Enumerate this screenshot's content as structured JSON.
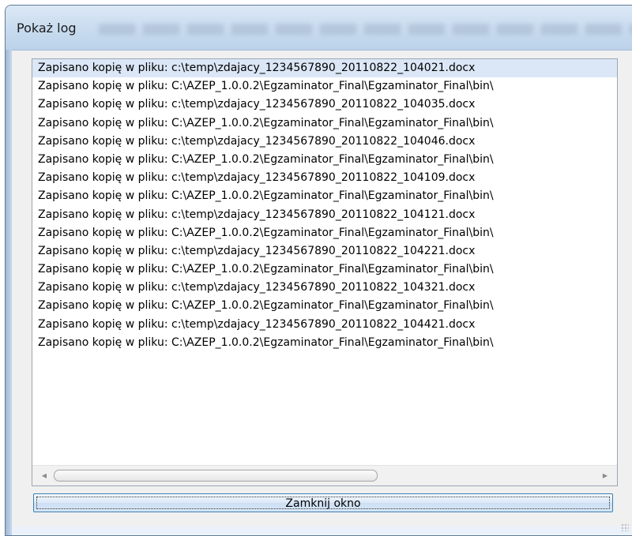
{
  "window": {
    "title": "Pokaż log"
  },
  "log": {
    "selected_index": 0,
    "entries": [
      "Zapisano kopię w pliku: c:\\temp\\zdajacy_1234567890_20110822_104021.docx",
      "Zapisano kopię w pliku: C:\\AZEP_1.0.0.2\\Egzaminator_Final\\Egzaminator_Final\\bin\\",
      "Zapisano kopię w pliku: c:\\temp\\zdajacy_1234567890_20110822_104035.docx",
      "Zapisano kopię w pliku: C:\\AZEP_1.0.0.2\\Egzaminator_Final\\Egzaminator_Final\\bin\\",
      "Zapisano kopię w pliku: c:\\temp\\zdajacy_1234567890_20110822_104046.docx",
      "Zapisano kopię w pliku: C:\\AZEP_1.0.0.2\\Egzaminator_Final\\Egzaminator_Final\\bin\\",
      "Zapisano kopię w pliku: c:\\temp\\zdajacy_1234567890_20110822_104109.docx",
      "Zapisano kopię w pliku: C:\\AZEP_1.0.0.2\\Egzaminator_Final\\Egzaminator_Final\\bin\\",
      "Zapisano kopię w pliku: c:\\temp\\zdajacy_1234567890_20110822_104121.docx",
      "Zapisano kopię w pliku: C:\\AZEP_1.0.0.2\\Egzaminator_Final\\Egzaminator_Final\\bin\\",
      "Zapisano kopię w pliku: c:\\temp\\zdajacy_1234567890_20110822_104221.docx",
      "Zapisano kopię w pliku: C:\\AZEP_1.0.0.2\\Egzaminator_Final\\Egzaminator_Final\\bin\\",
      "Zapisano kopię w pliku: c:\\temp\\zdajacy_1234567890_20110822_104321.docx",
      "Zapisano kopię w pliku: C:\\AZEP_1.0.0.2\\Egzaminator_Final\\Egzaminator_Final\\bin\\",
      "Zapisano kopię w pliku: c:\\temp\\zdajacy_1234567890_20110822_104421.docx",
      "Zapisano kopię w pliku: C:\\AZEP_1.0.0.2\\Egzaminator_Final\\Egzaminator_Final\\bin\\"
    ]
  },
  "close_button": {
    "label": "Zamknij okno"
  },
  "icons": {
    "scroll_left": "scroll-left-arrow-icon",
    "scroll_right": "scroll-right-arrow-icon",
    "resize_grip": "resize-grip-icon"
  },
  "colors": {
    "selection": "#dbe7f6",
    "button_border": "#3c7fb1",
    "window_frame": "#c8dbef"
  }
}
